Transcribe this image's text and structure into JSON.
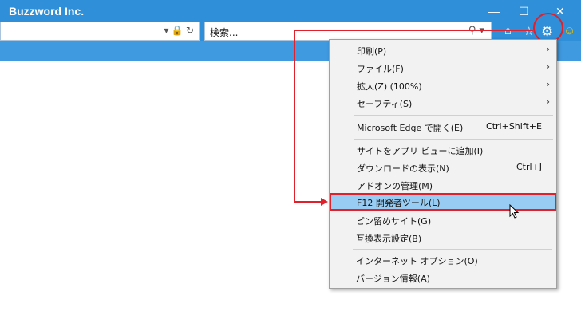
{
  "window": {
    "title": "Buzzword Inc.",
    "minimize_glyph": "—",
    "maximize_glyph": "☐",
    "close_glyph": "✕"
  },
  "address": {
    "icons": "▾ 🔒 ↻"
  },
  "search": {
    "placeholder": "検索...",
    "icon_glyph": "⚲ ▾"
  },
  "toolbar": {
    "home_glyph": "⌂",
    "favorites_glyph": "☆",
    "tools_glyph": "⚙",
    "smiley_glyph": "☺"
  },
  "menu": {
    "items": [
      {
        "label": "印刷(P)",
        "arrow": "›"
      },
      {
        "label": "ファイル(F)",
        "arrow": "›"
      },
      {
        "label": "拡大(Z) (100%)",
        "arrow": "›"
      },
      {
        "label": "セーフティ(S)",
        "arrow": "›"
      },
      {
        "label": "Microsoft Edge で開く(E)",
        "shortcut": "Ctrl+Shift+E"
      },
      {
        "label": "サイトをアプリ ビューに追加(I)"
      },
      {
        "label": "ダウンロードの表示(N)",
        "shortcut": "Ctrl+J"
      },
      {
        "label": "アドオンの管理(M)"
      },
      {
        "label": "F12 開発者ツール(L)"
      },
      {
        "label": "ピン留めサイト(G)"
      },
      {
        "label": "互換表示設定(B)"
      },
      {
        "label": "インターネット オプション(O)"
      },
      {
        "label": "バージョン情報(A)"
      }
    ]
  },
  "colors": {
    "titlebar": "#2f8fd8",
    "annotation_red": "#e0202a",
    "highlight": "#99ccf2"
  }
}
